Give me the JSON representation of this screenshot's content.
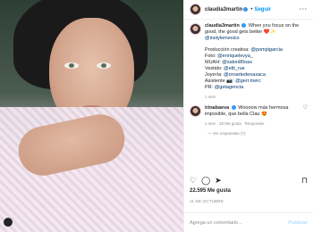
{
  "post": {
    "username": "claudia3martin",
    "follow": "Seguir",
    "more": "···"
  },
  "caption": {
    "username": "claudia3martin",
    "line1": " When you focus on the good, the good gets better ❤️✨",
    "handle1": "@instylemexico",
    "credits": [
      {
        "label": "Producción creativa: ",
        "handle": "@pompigarcia"
      },
      {
        "label": "Foto: ",
        "handle": "@enriquelevya_"
      },
      {
        "label": "MUAH: ",
        "handle": "@salon80oax"
      },
      {
        "label": "Vestido: ",
        "handle": "@elit_rue"
      },
      {
        "label": "Joyería: ",
        "handle": "@oroartedeoaxaca"
      },
      {
        "label": "Asistente 📷: ",
        "handle": "@gerr.merc"
      },
      {
        "label": "PR: ",
        "handle": "@getagencia"
      }
    ],
    "time": "1 sem"
  },
  "comment": {
    "username": "irinabaeva",
    "text": " Woooow más hermosa imposible, que bella Clau 😍",
    "time": "1 sem",
    "likes": "28 Me gusta",
    "reply": "Responder",
    "view_replies": "Ver respuestas (7)"
  },
  "actions": {
    "like": "♡",
    "comment": "◯",
    "share": "➤",
    "save": "⊓"
  },
  "likes": "22.595 Me gusta",
  "date": "11 DE OCTUBRE",
  "add_comment": {
    "placeholder": "Agrega un comentario...",
    "publish": "Publicar"
  }
}
